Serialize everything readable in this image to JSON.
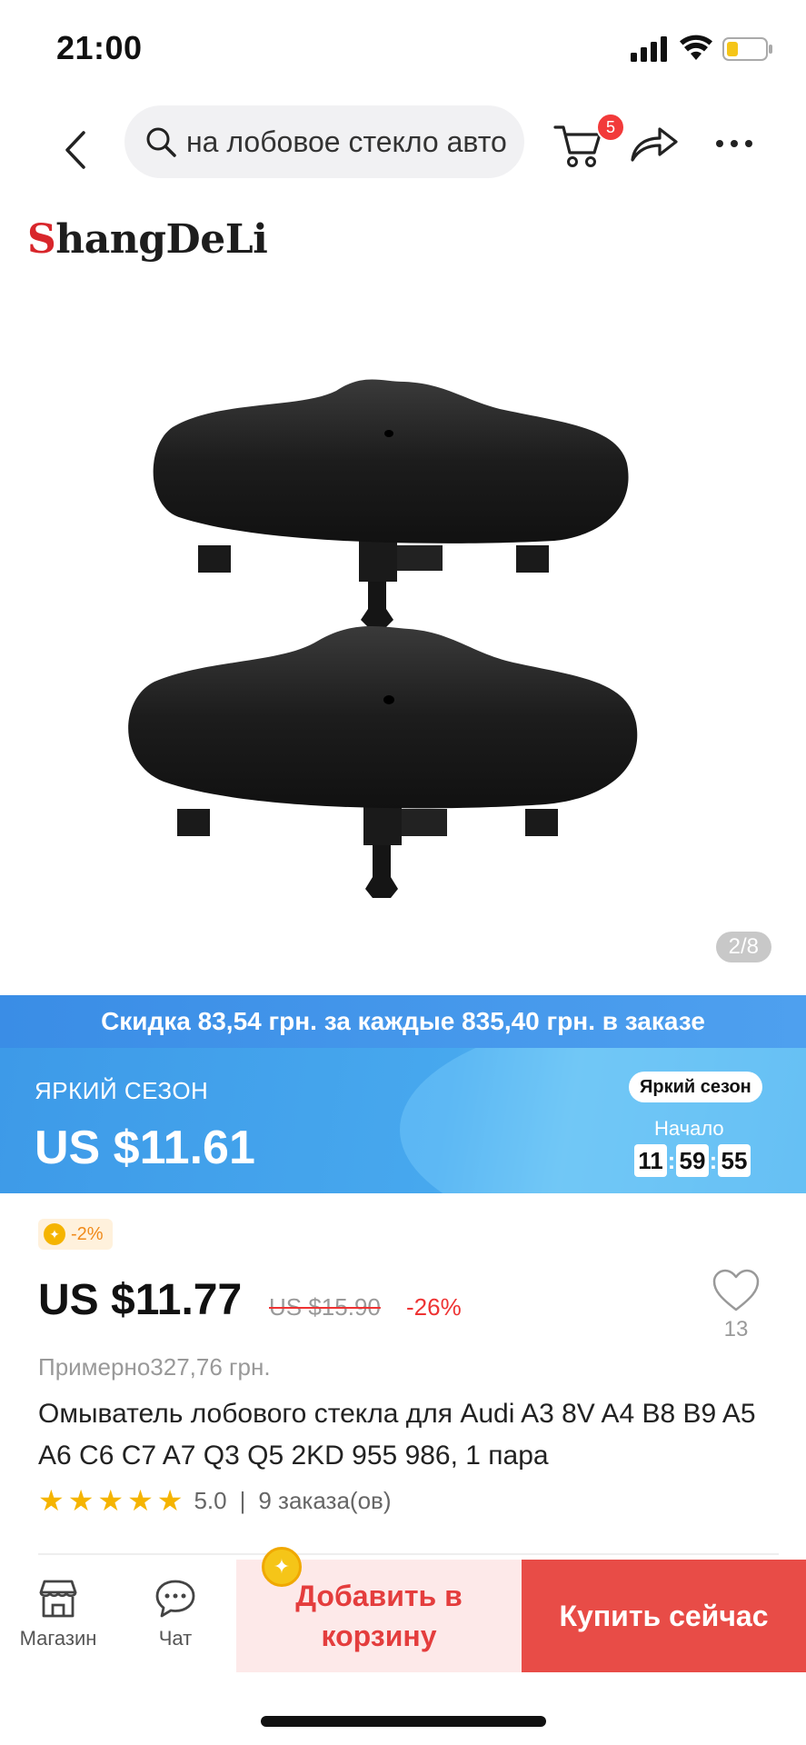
{
  "status_bar": {
    "time": "21:00"
  },
  "top_nav": {
    "search_value": "на лобовое стекло авто",
    "cart_count": "5"
  },
  "gallery": {
    "brand_first": "S",
    "brand_rest": "hangDeLi",
    "counter": "2/8"
  },
  "discount_banner": {
    "text": "Скидка 83,54 грн. за каждые 835,40 грн. в заказе"
  },
  "promo": {
    "label": "ЯРКИЙ СЕЗОН",
    "price": "US $11.61",
    "tag": "Яркий сезон",
    "start_label": "Начало",
    "timer": {
      "h": "11",
      "m": "59",
      "s": "55"
    }
  },
  "product": {
    "coin_discount": "-2%",
    "price": "US $11.77",
    "old_price": "US $15.90",
    "discount": "-26%",
    "wishlist_count": "13",
    "approx_price": "Примерно327,76 грн.",
    "title": "Омыватель лобового стекла для Audi A3 8V A4 B8 B9 A5 A6 C6 C7 A7 Q3 Q5 2KD 955 986, 1 пара",
    "rating": "5.0",
    "orders": "9 заказа(ов)"
  },
  "bottom_bar": {
    "store_label": "Магазин",
    "chat_label": "Чат",
    "add_to_cart": "Добавить в корзину",
    "buy_now": "Купить сейчас"
  },
  "colors": {
    "accent_red": "#e84c47",
    "promo_blue": "#3d9ae8",
    "star": "#f5b400"
  }
}
